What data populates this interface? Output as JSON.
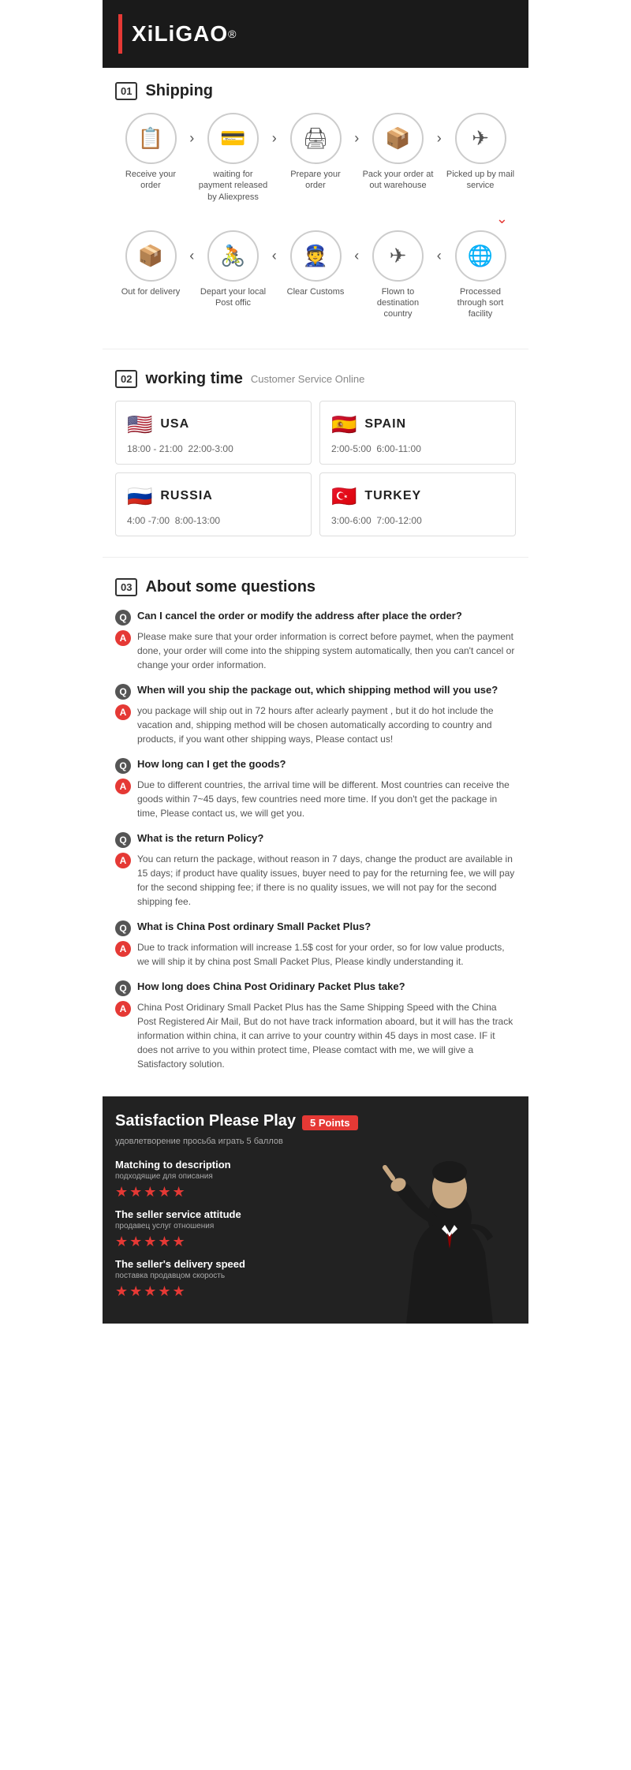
{
  "brand": {
    "name": "XiLiGAO",
    "reg": "®"
  },
  "sections": {
    "shipping": {
      "num": "01",
      "label": "Shipping"
    },
    "working": {
      "num": "02",
      "label": "working time",
      "sub": "Customer Service Online"
    },
    "faq": {
      "num": "03",
      "label": "About some questions"
    }
  },
  "shipping_steps_row1": [
    {
      "icon": "📋",
      "label": "Receive your order"
    },
    {
      "arrow": ">"
    },
    {
      "icon": "💳",
      "label": "waiting for payment released by Aliexpress"
    },
    {
      "arrow": ">"
    },
    {
      "icon": "🖨",
      "label": "Prepare your order"
    },
    {
      "arrow": ">"
    },
    {
      "icon": "📦",
      "label": "Pack your order at out warehouse"
    },
    {
      "arrow": ">"
    },
    {
      "icon": "✈",
      "label": "Picked up by mail service"
    }
  ],
  "shipping_steps_row2": [
    {
      "icon": "📦",
      "label": "Out for delivery"
    },
    {
      "arrow": "<"
    },
    {
      "icon": "🚴",
      "label": "Depart your local Post offic"
    },
    {
      "arrow": "<"
    },
    {
      "icon": "👮",
      "label": "Clear Customs"
    },
    {
      "arrow": "<"
    },
    {
      "icon": "✈",
      "label": "Flown to destination country"
    },
    {
      "arrow": "<"
    },
    {
      "icon": "🌐",
      "label": "Processed through sort facility"
    }
  ],
  "countries": [
    {
      "flag": "🇺🇸",
      "name": "USA",
      "times": [
        "18:00 - 21:00",
        "22:00-3:00"
      ]
    },
    {
      "flag": "🇪🇸",
      "name": "SPAIN",
      "times": [
        "2:00-5:00",
        "6:00-11:00"
      ]
    },
    {
      "flag": "🇷🇺",
      "name": "RUSSIA",
      "times": [
        "4:00 -7:00",
        "8:00-13:00"
      ]
    },
    {
      "flag": "🇹🇷",
      "name": "TURKEY",
      "times": [
        "3:00-6:00",
        "7:00-12:00"
      ]
    }
  ],
  "faq": [
    {
      "q": "Can I cancel the order or modify the address after place the order?",
      "a": "Please make sure that your order information is correct before paymet, when the payment done, your order will come into the shipping system automatically, then you can't cancel or change your order information."
    },
    {
      "q": "When will you ship the package out, which shipping method will you use?",
      "a": "you package will ship out in 72 hours after aclearly payment , but it do hot include the vacation and, shipping method will be chosen automatically according to country and products, if you want other shipping ways, Please contact us!"
    },
    {
      "q": "How long can I get the goods?",
      "a": "Due to different countries, the arrival time will be different. Most countries can receive the goods within 7~45 days, few countries need more time. If you don't get the package in time, Please contact us, we will get you."
    },
    {
      "q": "What is the return Policy?",
      "a": "You can return the package, without reason in 7 days, change the product are available in 15 days; if product have quality issues, buyer need to pay for the returning fee, we will pay for the second shipping fee; if there is no quality issues, we will not pay for the second shipping fee."
    },
    {
      "q": "What is China Post ordinary Small Packet Plus?",
      "a": "Due to track information will increase 1.5$ cost for your order, so for low value products, we will ship it by china post Small Packet Plus, Please kindly understanding it."
    },
    {
      "q": "How long does China Post Oridinary Packet Plus take?",
      "a": "China Post Oridinary Small Packet Plus has the Same Shipping Speed with the China Post Registered Air Mail, But do not have track information aboard, but it will has the track information within china, it can arrive to your country within 45 days in most case. IF it does not arrive to you within protect time, Please comtact with me, we will give a Satisfactory solution."
    }
  ],
  "satisfaction": {
    "title": "Satisfaction Please Play",
    "badge": "5 Points",
    "sub": "удовлетворение просьба играть 5 баллов",
    "ratings": [
      {
        "label": "Matching to description",
        "sub": "подходящие для описания",
        "stars": "★★★★★"
      },
      {
        "label": "The seller service attitude",
        "sub": "продавец услуг отношения",
        "stars": "★★★★★"
      },
      {
        "label": "The seller's delivery speed",
        "sub": "поставка продавцом скорость",
        "stars": "★★★★★"
      }
    ]
  }
}
